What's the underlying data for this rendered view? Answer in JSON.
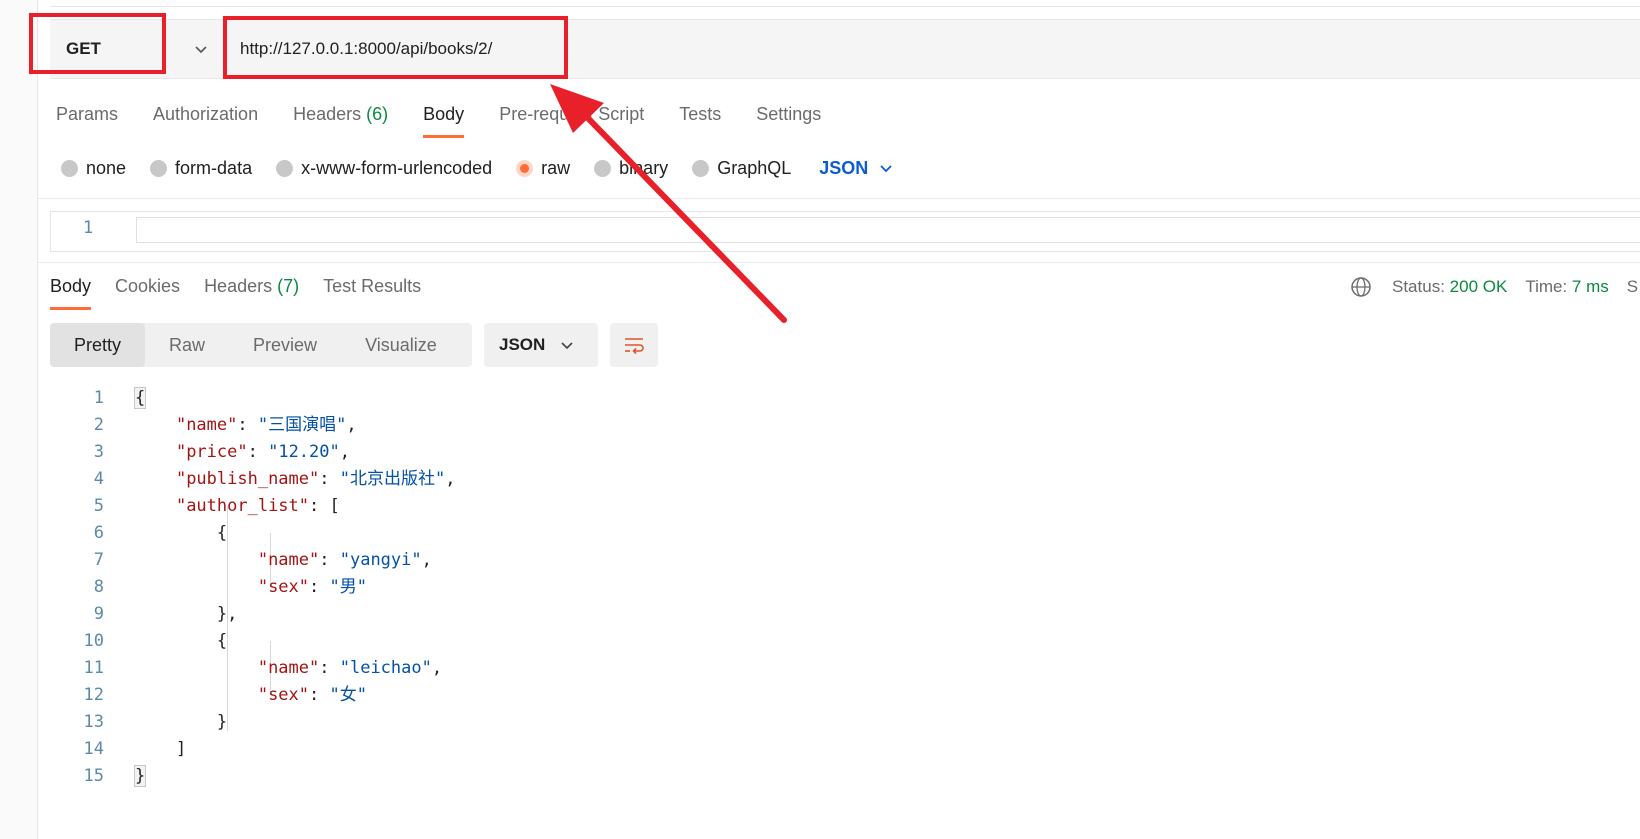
{
  "request": {
    "method": "GET",
    "url": "http://127.0.0.1:8000/api/books/2/"
  },
  "request_tabs": [
    {
      "label": "Params"
    },
    {
      "label": "Authorization"
    },
    {
      "label": "Headers",
      "count": "(6)"
    },
    {
      "label": "Body",
      "active": true
    },
    {
      "label": "Pre-request Script"
    },
    {
      "label": "Tests"
    },
    {
      "label": "Settings"
    }
  ],
  "body_types": {
    "none": "none",
    "form_data": "form-data",
    "urlencoded": "x-www-form-urlencoded",
    "raw": "raw",
    "binary": "binary",
    "graphql": "GraphQL",
    "format": "JSON",
    "selected": "raw"
  },
  "request_editor": {
    "line_number": "1"
  },
  "response_tabs": {
    "body": "Body",
    "cookies": "Cookies",
    "headers": "Headers",
    "headers_count": "(7)",
    "test_results": "Test Results"
  },
  "status": {
    "status_label": "Status:",
    "status_value": "200 OK",
    "time_label": "Time:",
    "time_value": "7 ms",
    "size_label_partial": "S"
  },
  "views": {
    "pretty": "Pretty",
    "raw": "Raw",
    "preview": "Preview",
    "visualize": "Visualize",
    "format": "JSON"
  },
  "response_lines": [
    {
      "n": "1"
    },
    {
      "n": "2"
    },
    {
      "n": "3"
    },
    {
      "n": "4"
    },
    {
      "n": "5"
    },
    {
      "n": "6"
    },
    {
      "n": "7"
    },
    {
      "n": "8"
    },
    {
      "n": "9"
    },
    {
      "n": "10"
    },
    {
      "n": "11"
    },
    {
      "n": "12"
    },
    {
      "n": "13"
    },
    {
      "n": "14"
    },
    {
      "n": "15"
    }
  ],
  "response_json": {
    "k_name": "\"name\"",
    "v_name": "\"三国演唱\"",
    "k_price": "\"price\"",
    "v_price": "\"12.20\"",
    "k_publish": "\"publish_name\"",
    "v_publish": "\"北京出版社\"",
    "k_authors": "\"author_list\"",
    "a1_k_name": "\"name\"",
    "a1_v_name": "\"yangyi\"",
    "a1_k_sex": "\"sex\"",
    "a1_v_sex": "\"男\"",
    "a2_k_name": "\"name\"",
    "a2_v_name": "\"leichao\"",
    "a2_k_sex": "\"sex\"",
    "a2_v_sex": "\"女\""
  },
  "colors": {
    "accent": "#ff6c37",
    "annotation_red": "#e8202a",
    "status_green": "#0b8a3f",
    "json_blue": "#0b5bd3"
  }
}
